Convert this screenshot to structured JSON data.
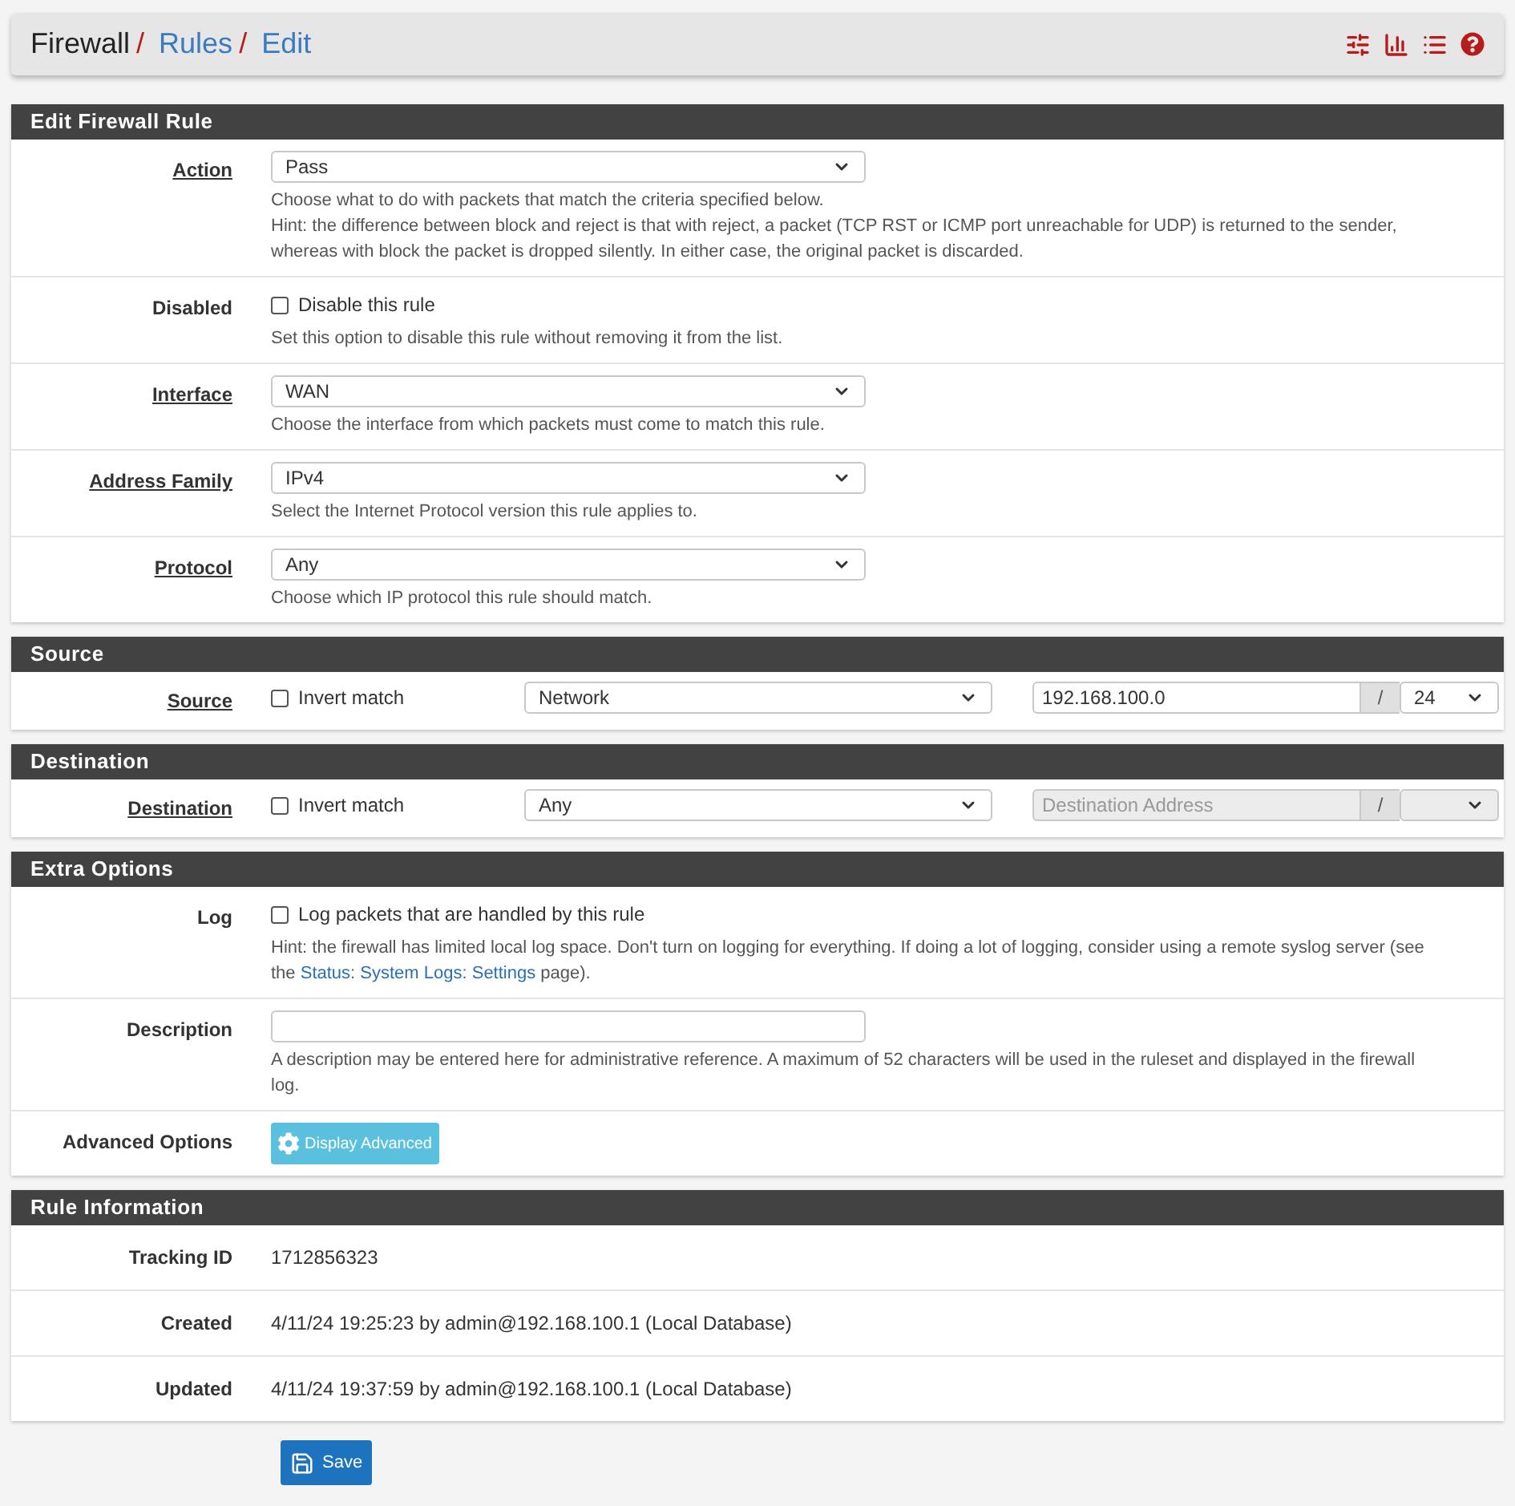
{
  "breadcrumb": [
    {
      "label": "Firewall",
      "link": false,
      "separator": "/"
    },
    {
      "label": "Rules",
      "link": true,
      "separator": "/"
    },
    {
      "label": "Edit",
      "link": true
    }
  ],
  "sections": [
    {
      "title": "Edit Firewall Rule",
      "rows": [
        {
          "kind": "select",
          "label": "Action",
          "label_link": true,
          "value": "Pass",
          "help": [
            [
              {
                "text": "Choose what to do with packets that match the criteria specified below."
              }
            ],
            [
              {
                "text": "Hint: the difference between block and reject is that with reject, a packet (TCP RST or ICMP port unreachable for UDP) is returned to the sender, whereas with block the packet is dropped silently. In either case, the original packet is discarded."
              }
            ]
          ]
        },
        {
          "kind": "checkbox",
          "label": "Disabled",
          "label_link": false,
          "checked": false,
          "text": "Disable this rule",
          "help": [
            [
              {
                "text": "Set this option to disable this rule without removing it from the list."
              }
            ]
          ]
        },
        {
          "kind": "select",
          "label": "Interface",
          "label_link": true,
          "value": "WAN",
          "help": [
            [
              {
                "text": "Choose the interface from which packets must come to match this rule."
              }
            ]
          ]
        },
        {
          "kind": "select",
          "label": "Address Family",
          "label_link": true,
          "value": "IPv4",
          "help": [
            [
              {
                "text": "Select the Internet Protocol version this rule applies to."
              }
            ]
          ]
        },
        {
          "kind": "select",
          "label": "Protocol",
          "label_link": true,
          "value": "Any",
          "help": [
            [
              {
                "text": "Choose which IP protocol this rule should match."
              }
            ]
          ]
        }
      ]
    },
    {
      "title": "Source",
      "rows": [
        {
          "kind": "address",
          "label": "Source",
          "label_link": true,
          "checked": false,
          "text": "Invert match",
          "type": "Network",
          "address": {
            "value": "192.168.100.0",
            "disabled": false
          },
          "slash": "/",
          "mask": {
            "value": "24",
            "disabled": false
          }
        }
      ]
    },
    {
      "title": "Destination",
      "rows": [
        {
          "kind": "address",
          "label": "Destination",
          "label_link": true,
          "checked": false,
          "text": "Invert match",
          "type": "Any",
          "address": {
            "placeholder": "Destination Address",
            "disabled": true
          },
          "slash": "/",
          "mask": {
            "disabled": true
          }
        }
      ]
    },
    {
      "title": "Extra Options",
      "rows": [
        {
          "kind": "checkbox",
          "label": "Log",
          "label_link": false,
          "checked": false,
          "text": "Log packets that are handled by this rule",
          "help": [
            [
              {
                "text": "Hint: the firewall has limited local log space. Don't turn on logging for everything. If doing a lot of logging, consider using a remote syslog server (see the "
              },
              {
                "text": "Status: System Logs: Settings",
                "link": true
              },
              {
                "text": " page)."
              }
            ]
          ]
        },
        {
          "kind": "input",
          "label": "Description",
          "label_link": false,
          "help": [
            [
              {
                "text": "A description may be entered here for administrative reference. A maximum of 52 characters will be used in the ruleset and displayed in the firewall log."
              }
            ]
          ]
        },
        {
          "kind": "button",
          "label": "Advanced Options",
          "label_link": false,
          "button": "Display Advanced"
        }
      ]
    },
    {
      "title": "Rule Information",
      "rows": [
        {
          "kind": "text",
          "label": "Tracking ID",
          "label_link": false,
          "text": "1712856323"
        },
        {
          "kind": "text",
          "label": "Created",
          "label_link": false,
          "text": "4/11/24 19:25:23 by admin@192.168.100.1 (Local Database)"
        },
        {
          "kind": "text",
          "label": "Updated",
          "label_link": false,
          "text": "4/11/24 19:37:59 by admin@192.168.100.1 (Local Database)"
        }
      ]
    }
  ],
  "save_button": "Save"
}
